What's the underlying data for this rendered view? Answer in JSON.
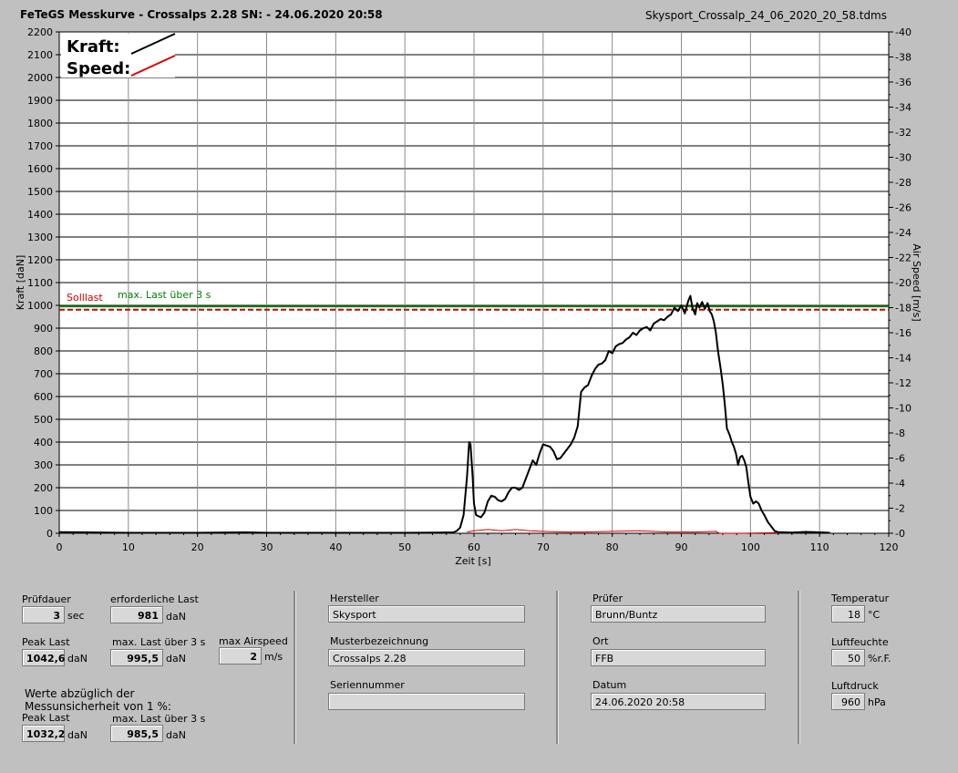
{
  "header": {
    "title": "FeTeGS Messkurve - Crossalps 2.28  SN:  - 24.06.2020 20:58",
    "file": "Skysport_Crossalp_24_06_2020_20_58.tdms"
  },
  "chart_data": {
    "type": "line",
    "xlabel": "Zeit [s]",
    "ylabel_left": "Kraft [daN]",
    "ylabel_right": "Air Speed [m/s]",
    "xlim": [
      0,
      120
    ],
    "ylim_left": [
      0,
      2200
    ],
    "ylim_right": [
      0,
      40
    ],
    "x_ticks": [
      "0",
      "10",
      "20",
      "30",
      "40",
      "50",
      "60",
      "70",
      "80",
      "90",
      "100",
      "110",
      "120"
    ],
    "y_ticks_left": [
      "0",
      "100",
      "200",
      "300",
      "400",
      "500",
      "600",
      "700",
      "800",
      "900",
      "1000",
      "1100",
      "1200",
      "1300",
      "1400",
      "1500",
      "1600",
      "1700",
      "1800",
      "1900",
      "2000",
      "2100",
      "2200"
    ],
    "y_ticks_right": [
      "0",
      "2",
      "4",
      "6",
      "8",
      "10",
      "12",
      "14",
      "16",
      "18",
      "20",
      "22",
      "24",
      "26",
      "28",
      "30",
      "32",
      "34",
      "36",
      "38",
      "40"
    ],
    "grid": true,
    "legend": {
      "placement": "top-left",
      "items": [
        {
          "name": "Kraft:",
          "color": "#000000"
        },
        {
          "name": "Speed:",
          "color": "#dd0000"
        }
      ]
    },
    "reference_lines": [
      {
        "label": "Solllast",
        "y": 981,
        "color": "#cc0000",
        "style": "dashed"
      },
      {
        "label": "max. Last über  3 s",
        "y": 995.5,
        "color": "#008000",
        "style": "solid"
      }
    ],
    "series": [
      {
        "name": "Kraft",
        "axis": "left",
        "color": "#000000",
        "points": [
          [
            0,
            5
          ],
          [
            4,
            4
          ],
          [
            10,
            2
          ],
          [
            20,
            2
          ],
          [
            27,
            4
          ],
          [
            30,
            2
          ],
          [
            40,
            2
          ],
          [
            50,
            2
          ],
          [
            55,
            3
          ],
          [
            57,
            4
          ],
          [
            57.5,
            10
          ],
          [
            58,
            25
          ],
          [
            58.5,
            80
          ],
          [
            59,
            250
          ],
          [
            59.3,
            400
          ],
          [
            59.5,
            390
          ],
          [
            59.8,
            250
          ],
          [
            60,
            130
          ],
          [
            60.3,
            80
          ],
          [
            61,
            70
          ],
          [
            61.5,
            90
          ],
          [
            62,
            140
          ],
          [
            62.5,
            165
          ],
          [
            63,
            160
          ],
          [
            63.5,
            145
          ],
          [
            64,
            140
          ],
          [
            64.5,
            150
          ],
          [
            65,
            180
          ],
          [
            65.5,
            200
          ],
          [
            66,
            200
          ],
          [
            66.5,
            190
          ],
          [
            67,
            200
          ],
          [
            67.5,
            240
          ],
          [
            68,
            280
          ],
          [
            68.5,
            320
          ],
          [
            69,
            300
          ],
          [
            69.5,
            350
          ],
          [
            70,
            390
          ],
          [
            70.5,
            385
          ],
          [
            71,
            380
          ],
          [
            71.5,
            360
          ],
          [
            72,
            325
          ],
          [
            72.5,
            330
          ],
          [
            73,
            350
          ],
          [
            73.5,
            370
          ],
          [
            74,
            390
          ],
          [
            74.5,
            420
          ],
          [
            75,
            470
          ],
          [
            75.5,
            620
          ],
          [
            76,
            640
          ],
          [
            76.5,
            650
          ],
          [
            77,
            690
          ],
          [
            77.5,
            720
          ],
          [
            78,
            740
          ],
          [
            78.5,
            745
          ],
          [
            79,
            760
          ],
          [
            79.5,
            800
          ],
          [
            80,
            790
          ],
          [
            80.5,
            820
          ],
          [
            81,
            830
          ],
          [
            81.5,
            835
          ],
          [
            82,
            850
          ],
          [
            82.5,
            860
          ],
          [
            83,
            880
          ],
          [
            83.5,
            870
          ],
          [
            84,
            890
          ],
          [
            84.5,
            900
          ],
          [
            85,
            905
          ],
          [
            85.5,
            890
          ],
          [
            86,
            920
          ],
          [
            86.5,
            930
          ],
          [
            87,
            940
          ],
          [
            87.5,
            935
          ],
          [
            88,
            950
          ],
          [
            88.5,
            960
          ],
          [
            89,
            990
          ],
          [
            89.5,
            975
          ],
          [
            90,
            1000
          ],
          [
            90.5,
            965
          ],
          [
            91,
            1020
          ],
          [
            91.3,
            1042
          ],
          [
            91.6,
            990
          ],
          [
            92,
            960
          ],
          [
            92.3,
            1010
          ],
          [
            92.6,
            990
          ],
          [
            93,
            1015
          ],
          [
            93.4,
            985
          ],
          [
            93.8,
            1010
          ],
          [
            94.1,
            975
          ],
          [
            94.4,
            960
          ],
          [
            94.7,
            930
          ],
          [
            95,
            880
          ],
          [
            95.3,
            800
          ],
          [
            95.7,
            720
          ],
          [
            96,
            650
          ],
          [
            96.3,
            560
          ],
          [
            96.6,
            460
          ],
          [
            97,
            430
          ],
          [
            97.3,
            400
          ],
          [
            97.6,
            380
          ],
          [
            97.9,
            350
          ],
          [
            98.2,
            300
          ],
          [
            98.5,
            335
          ],
          [
            98.8,
            340
          ],
          [
            99.1,
            320
          ],
          [
            99.4,
            290
          ],
          [
            99.7,
            220
          ],
          [
            100,
            160
          ],
          [
            100.4,
            130
          ],
          [
            100.8,
            140
          ],
          [
            101.2,
            130
          ],
          [
            101.6,
            100
          ],
          [
            102,
            80
          ],
          [
            102.5,
            50
          ],
          [
            103,
            30
          ],
          [
            103.5,
            10
          ],
          [
            104,
            5
          ],
          [
            106,
            3
          ],
          [
            108,
            6
          ],
          [
            110,
            4
          ],
          [
            111.5,
            2
          ]
        ]
      },
      {
        "name": "Speed",
        "axis": "right",
        "color": "#dd0000",
        "points": [
          [
            59,
            0.1
          ],
          [
            60,
            0.2
          ],
          [
            62,
            0.3
          ],
          [
            64,
            0.2
          ],
          [
            66,
            0.3
          ],
          [
            68,
            0.2
          ],
          [
            70,
            0.15
          ],
          [
            73,
            0.1
          ],
          [
            76,
            0.1
          ],
          [
            80,
            0.15
          ],
          [
            84,
            0.2
          ],
          [
            88,
            0.1
          ],
          [
            92,
            0.1
          ],
          [
            95,
            0.15
          ],
          [
            95.5,
            0
          ],
          [
            99,
            0
          ],
          [
            104,
            0.05
          ]
        ]
      }
    ]
  },
  "panel": {
    "pruefdauer_label": "Prüfdauer",
    "pruefdauer_value": "3",
    "pruefdauer_unit": "sec",
    "erf_last_label": "erforderliche Last",
    "erf_last_value": "981",
    "erf_last_unit": "daN",
    "peak_last_label": "Peak Last",
    "peak_last_value": "1042,6",
    "peak_last_unit": "daN",
    "max_last_label": "max. Last über  3 s",
    "max_last_value": "995,5",
    "max_last_unit": "daN",
    "max_airspeed_label": "max Airspeed",
    "max_airspeed_value": "2",
    "max_airspeed_unit": "m/s",
    "werte_note_1": "Werte abzüglich der",
    "werte_note_2": "Messunsicherheit von 1  %:",
    "peak_last2_label": "Peak Last",
    "peak_last2_value": "1032,2",
    "peak_last2_unit": "daN",
    "max_last2_label": "max. Last über  3 s",
    "max_last2_value": "985,5",
    "max_last2_unit": "daN",
    "hersteller_label": "Hersteller",
    "hersteller_value": "Skysport",
    "muster_label": "Musterbezeichnung",
    "muster_value": "Crossalps 2.28",
    "serien_label": "Seriennummer",
    "serien_value": "",
    "pruefer_label": "Prüfer",
    "pruefer_value": "Brunn/Buntz",
    "ort_label": "Ort",
    "ort_value": "FFB",
    "datum_label": "Datum",
    "datum_value": "24.06.2020 20:58",
    "temp_label": "Temperatur",
    "temp_value": "18",
    "temp_unit": "°C",
    "feuchte_label": "Luftfeuchte",
    "feuchte_value": "50",
    "feuchte_unit": "%r.F.",
    "druck_label": "Luftdruck",
    "druck_value": "960",
    "druck_unit": "hPa"
  }
}
